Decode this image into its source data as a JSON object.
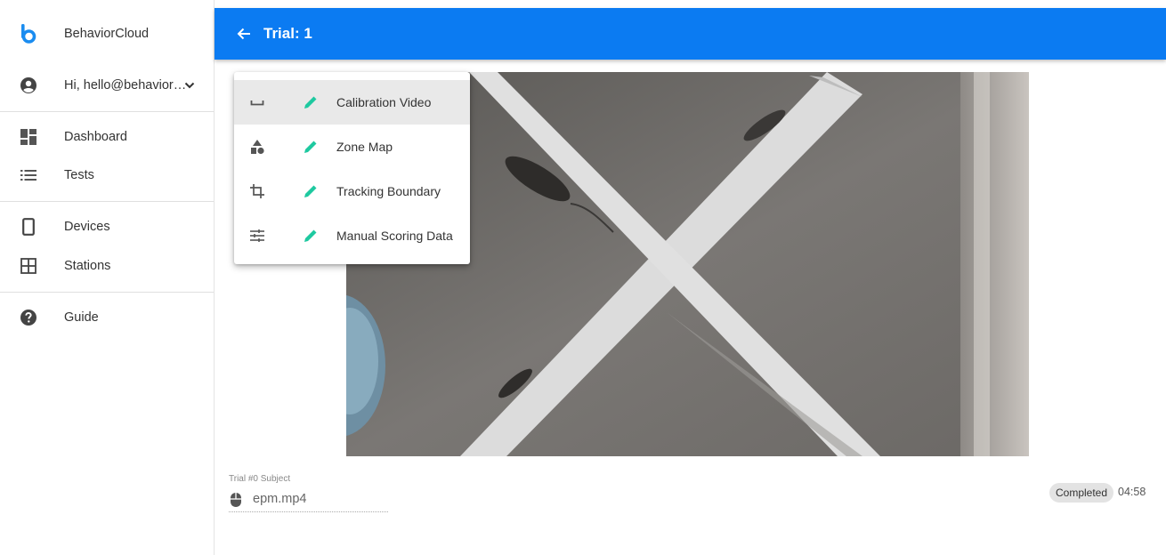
{
  "sidebar": {
    "brand": {
      "label": "BehaviorCloud",
      "icon": "behaviorcloud-logo"
    },
    "account": {
      "label": "Hi, hello@behavior…",
      "icon": "account-circle-icon",
      "chevron": "chevron-down-icon"
    },
    "nav_groups": [
      [
        {
          "label": "Dashboard",
          "icon": "dashboard-icon"
        },
        {
          "label": "Tests",
          "icon": "list-icon"
        }
      ],
      [
        {
          "label": "Devices",
          "icon": "phone-device-icon"
        },
        {
          "label": "Stations",
          "icon": "grid-icon"
        }
      ],
      [
        {
          "label": "Guide",
          "icon": "help-icon"
        }
      ]
    ]
  },
  "appbar": {
    "title": "Trial: 1",
    "back_icon": "arrow-back-icon",
    "color": "#0b7bf2"
  },
  "menu": {
    "items": [
      {
        "label": "Calibration Video",
        "icon": "space-bar-icon",
        "action_icon": "edit-pencil-icon",
        "active": true
      },
      {
        "label": "Zone Map",
        "icon": "shapes-icon",
        "action_icon": "edit-pencil-icon",
        "active": false
      },
      {
        "label": "Tracking Boundary",
        "icon": "crop-icon",
        "action_icon": "edit-pencil-icon",
        "active": false
      },
      {
        "label": "Manual Scoring Data",
        "icon": "tune-icon",
        "action_icon": "edit-pencil-icon",
        "active": false
      }
    ],
    "pencil_color": "#1ec9a0"
  },
  "video": {
    "icon": "video-frame"
  },
  "subject": {
    "label": "Trial #0 Subject",
    "value": "epm.mp4",
    "icon": "mouse-icon"
  },
  "status": {
    "chip": "Completed",
    "duration": "04:58"
  }
}
